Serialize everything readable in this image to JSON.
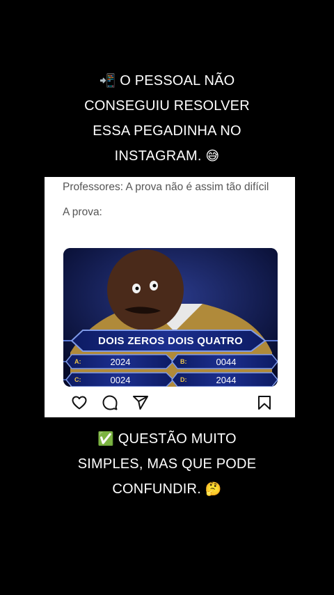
{
  "caption_top": {
    "lines": [
      "O PESSOAL NÃO",
      "CONSEGUIU RESOLVER",
      "ESSA PEGADINHA NO",
      "INSTAGRAM."
    ],
    "lead_emoji": "📲",
    "tail_emoji": "😅"
  },
  "post": {
    "text_line1": "Professores: A prova não é assim tão difícil",
    "text_line2": "A prova:",
    "meme": {
      "question": "DOIS ZEROS DOIS QUATRO",
      "answers": [
        {
          "letter": "A:",
          "value": "2024"
        },
        {
          "letter": "B:",
          "value": "0044"
        },
        {
          "letter": "C:",
          "value": "0024"
        },
        {
          "letter": "D:",
          "value": "2044"
        }
      ]
    },
    "actions": [
      "heart-icon",
      "comment-icon",
      "share-icon",
      "bookmark-icon"
    ]
  },
  "caption_bottom": {
    "lines": [
      "QUESTÃO MUITO",
      "SIMPLES, MAS QUE PODE",
      "CONFUNDIR."
    ],
    "lead_emoji": "✅",
    "tail_emoji": "🤔"
  }
}
